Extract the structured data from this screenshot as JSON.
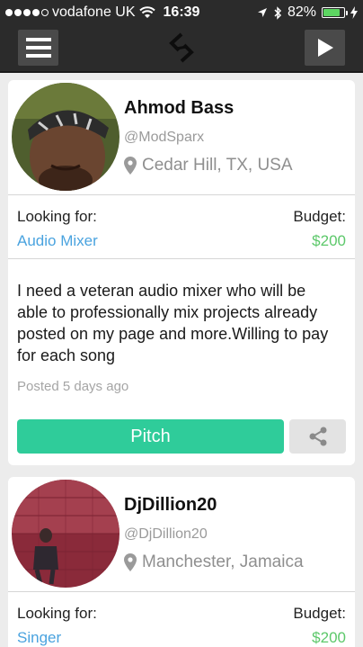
{
  "status_bar": {
    "carrier": "vodafone UK",
    "time": "16:39",
    "battery_percent": "82%",
    "battery_level": 0.82,
    "icons": [
      "signal-dots-icon",
      "wifi-icon",
      "location-arrow-icon",
      "bluetooth-icon",
      "battery-icon",
      "charging-bolt-icon"
    ]
  },
  "nav_bar": {
    "icons": [
      "hamburger-menu-icon",
      "app-logo-icon",
      "play-icon"
    ]
  },
  "posts": [
    {
      "name": "Ahmod Bass",
      "handle": "@ModSparx",
      "location": "Cedar Hill, TX, USA",
      "looking_for_label": "Looking for:",
      "looking_for_value": "Audio Mixer",
      "budget_label": "Budget:",
      "budget_value": "$200",
      "description": "I need a veteran audio mixer who will be able to professionally mix projects already posted on my page and more.Willing to pay for each song",
      "posted": "Posted 5 days ago",
      "pitch_label": "Pitch"
    },
    {
      "name": "DjDillion20",
      "handle": "@DjDillion20",
      "location": "Manchester, Jamaica",
      "looking_for_label": "Looking for:",
      "looking_for_value": "Singer",
      "budget_label": "Budget:",
      "budget_value": "$200"
    }
  ],
  "colors": {
    "bar_background": "#2b2b2b",
    "accent_green": "#2fcc9a",
    "link_blue": "#4aa3df",
    "budget_green": "#5cc86a"
  }
}
